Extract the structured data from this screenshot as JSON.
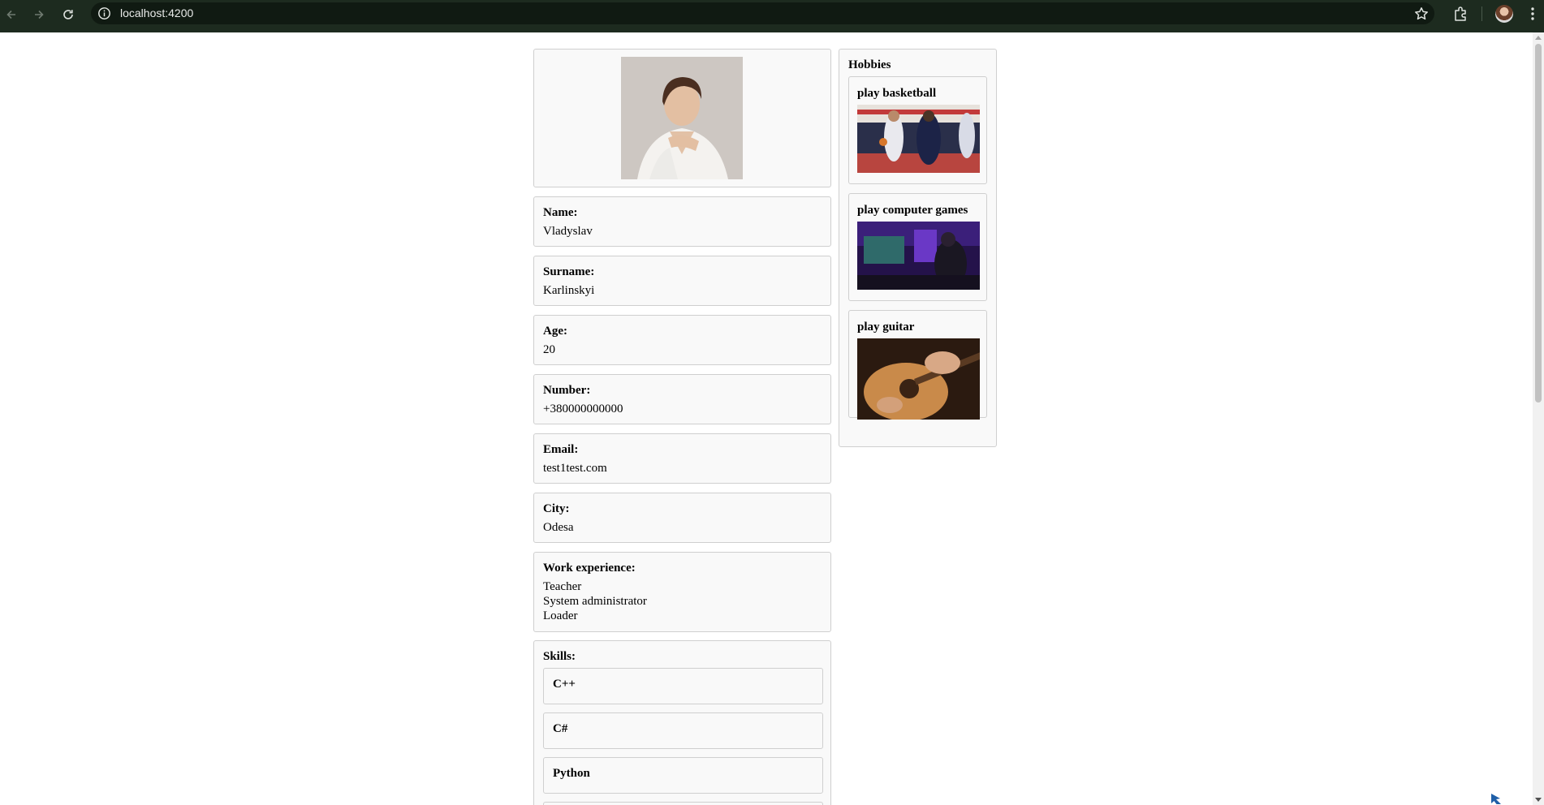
{
  "browser": {
    "url": "localhost:4200",
    "icons": [
      "back-icon",
      "forward-icon",
      "reload-icon",
      "info-icon",
      "star-icon",
      "extensions-icon",
      "profile-avatar",
      "menu-icon"
    ]
  },
  "profile": {
    "photo_alt": "profile photo",
    "fields": [
      {
        "label": "Name:",
        "value": "Vladyslav"
      },
      {
        "label": "Surname:",
        "value": "Karlinskyi"
      },
      {
        "label": "Age:",
        "value": "20"
      },
      {
        "label": "Number:",
        "value": "+380000000000"
      },
      {
        "label": "Email:",
        "value": "test1test.com"
      },
      {
        "label": "City:",
        "value": "Odesa"
      }
    ],
    "work_experience": {
      "label": "Work experience:",
      "items": [
        "Teacher",
        "System administrator",
        "Loader"
      ]
    },
    "skills": {
      "label": "Skills:",
      "items": [
        "C++",
        "C#",
        "Python"
      ]
    }
  },
  "hobbies": {
    "title": "Hobbies",
    "items": [
      {
        "label": "play basketball"
      },
      {
        "label": "play computer games"
      },
      {
        "label": "play guitar"
      }
    ]
  }
}
